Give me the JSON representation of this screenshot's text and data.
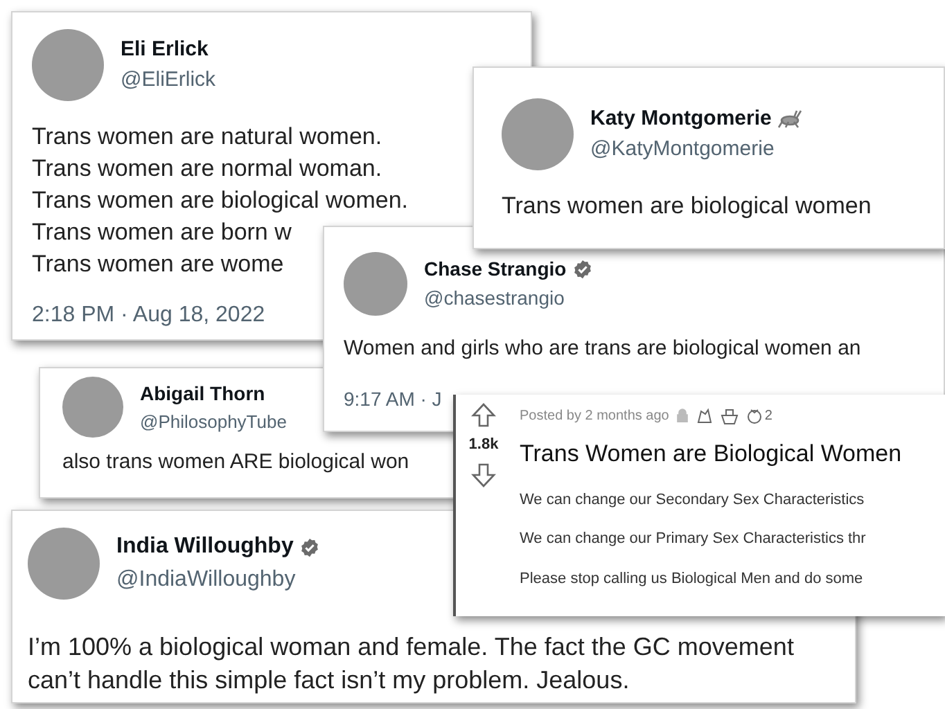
{
  "tweets": [
    {
      "name": "Eli Erlick",
      "handle": "@EliErlick",
      "verified": false,
      "emoji_icon": false,
      "lines": [
        "Trans women are natural women.",
        "Trans women are normal woman.",
        "Trans women are biological women.",
        "Trans women are born w",
        "Trans women are wome"
      ],
      "timestamp": "2:18 PM · Aug 18, 2022"
    },
    {
      "name": "Katy Montgomerie",
      "handle": "@KatyMontgomerie",
      "verified": false,
      "emoji_icon": true,
      "lines": [
        "Trans women are biological women"
      ]
    },
    {
      "name": "Chase Strangio",
      "handle": "@chasestrangio",
      "verified": true,
      "emoji_icon": false,
      "lines": [
        "Women and girls who are trans are biological women an"
      ],
      "timestamp": "9:17 AM · J"
    },
    {
      "name": "Abigail Thorn",
      "handle": "@PhilosophyTube",
      "verified": false,
      "emoji_icon": false,
      "lines": [
        "also trans women ARE biological won"
      ]
    },
    {
      "name": "India Willoughby",
      "handle": "@IndiaWilloughby",
      "verified": true,
      "emoji_icon": false,
      "lines": [
        "I’m 100% a biological woman and female. The fact the GC movement can’t handle this simple fact isn’t my problem. Jealous."
      ]
    }
  ],
  "reddit_post": {
    "votes": "1.8k",
    "meta": "Posted by 2 months ago",
    "award_count": "2",
    "title": "Trans Women are Biological Women",
    "paragraphs": [
      "We can change our Secondary Sex Characteristics",
      "We can change our Primary Sex Characteristics thr",
      "Please stop calling us Biological Men and do some"
    ]
  }
}
